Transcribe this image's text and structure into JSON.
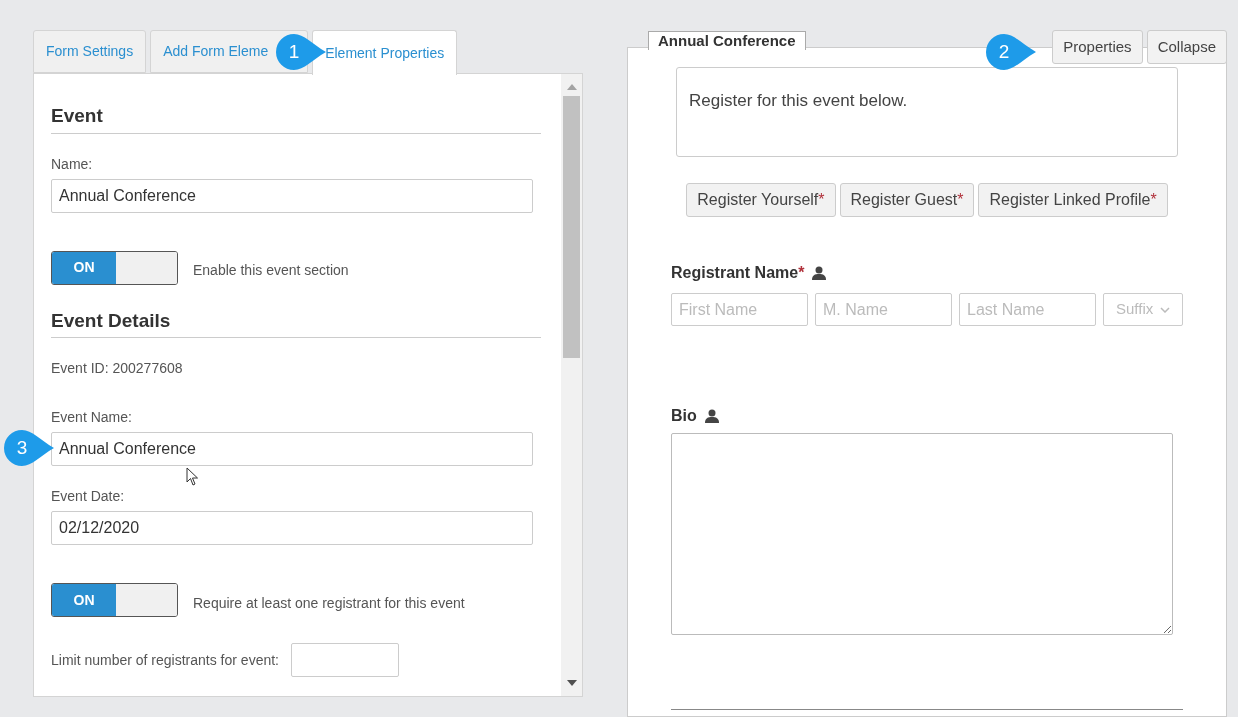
{
  "left_panel": {
    "tabs": [
      {
        "label": "Form Settings",
        "selected": false
      },
      {
        "label": "Add Form Eleme",
        "selected": false
      },
      {
        "label": "Element Properties",
        "selected": true
      }
    ],
    "items": [
      {
        "kind": "heading",
        "text": "Event"
      },
      {
        "kind": "field",
        "label": "Name:",
        "value": "Annual Conference"
      },
      {
        "kind": "toggle",
        "state_label": "ON",
        "on": true,
        "label": "Enable this event section"
      },
      {
        "kind": "heading",
        "text": "Event Details"
      },
      {
        "kind": "text",
        "text": "Event ID: 200277608"
      },
      {
        "kind": "field",
        "label": "Event Name:",
        "value": "Annual Conference"
      },
      {
        "kind": "field",
        "label": "Event Date:",
        "value": "02/12/2020"
      },
      {
        "kind": "toggle",
        "state_label": "ON",
        "on": true,
        "label": "Require at least one registrant for this event"
      },
      {
        "kind": "inline_field",
        "label": "Limit number of registrants for event:",
        "value": ""
      }
    ]
  },
  "right_panel": {
    "tab_label": "Annual Conference",
    "buttons": [
      "Properties",
      "Collapse"
    ],
    "intro": "Register for this event below.",
    "register_buttons": [
      {
        "label": "Register Yourself",
        "required_mark": "*"
      },
      {
        "label": "Register Guest",
        "required_mark": "*"
      },
      {
        "label": "Register Linked Profile",
        "required_mark": "*"
      }
    ],
    "registrant_name": {
      "label": "Registrant Name",
      "required_mark": "*",
      "placeholders": [
        "First Name",
        "M. Name",
        "Last Name"
      ],
      "suffix_placeholder": "Suffix"
    },
    "bio": {
      "label": "Bio"
    }
  },
  "callouts": [
    "1",
    "2",
    "3"
  ]
}
